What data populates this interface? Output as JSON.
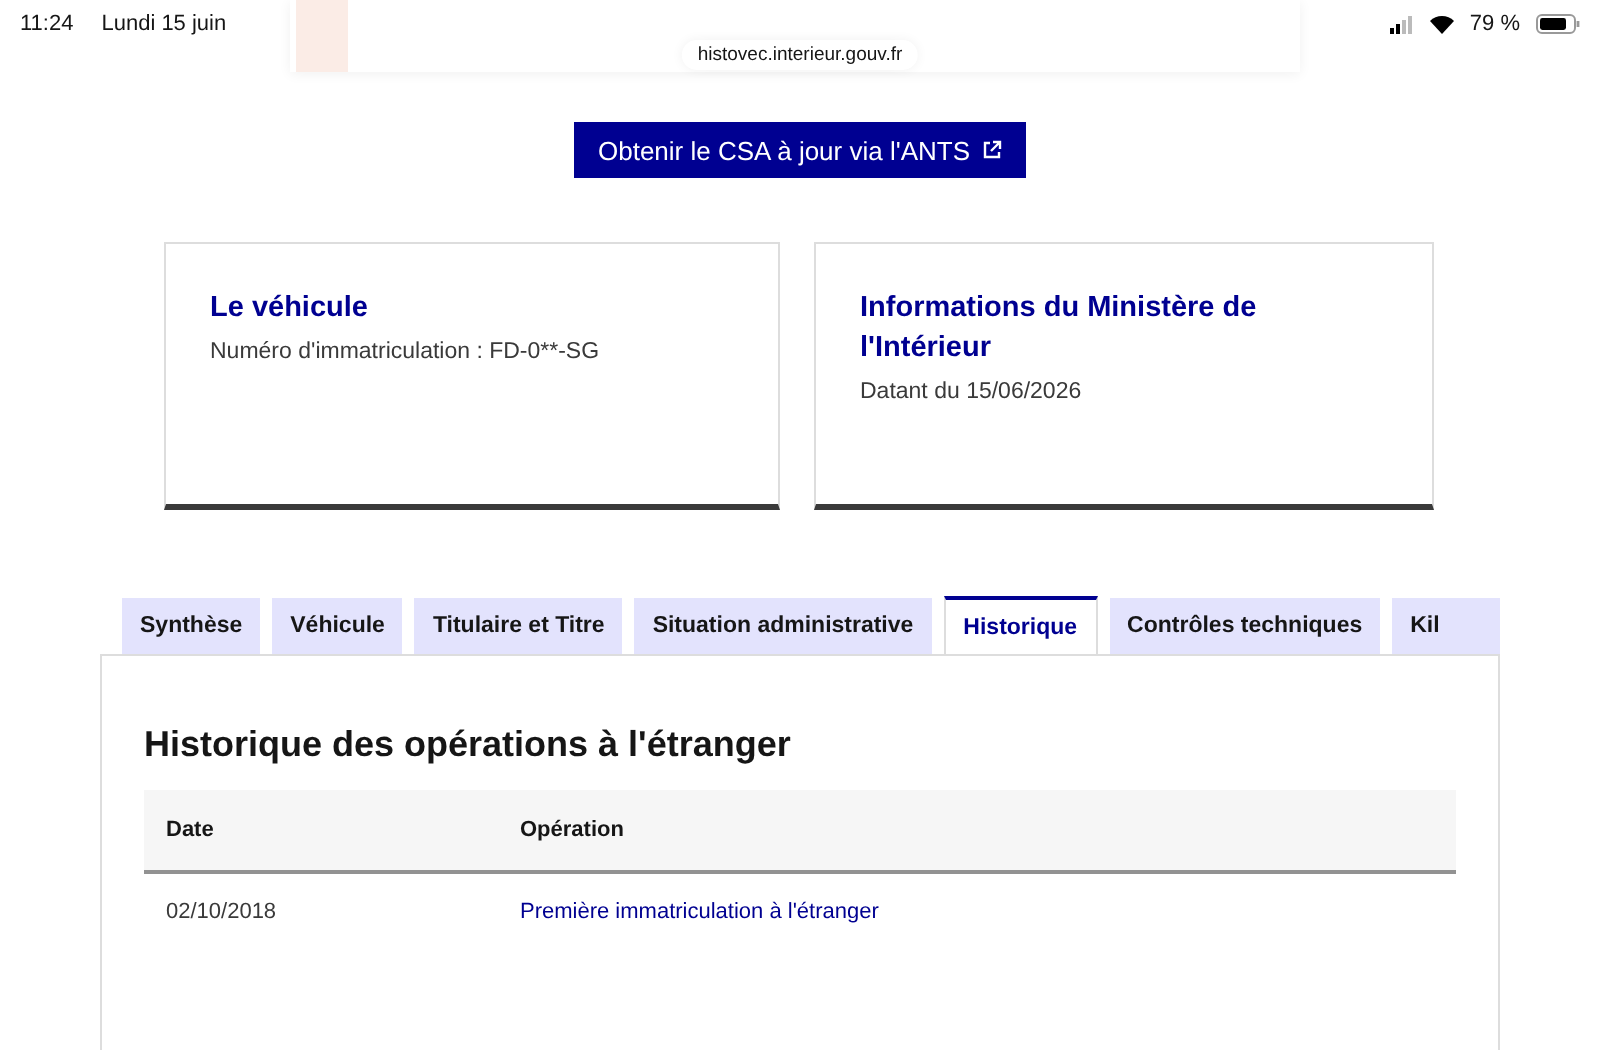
{
  "status_bar": {
    "time": "11:24",
    "date": "Lundi 15 juin",
    "battery": "79 %"
  },
  "address_bar": {
    "url": "histovec.interieur.gouv.fr"
  },
  "csa_button": {
    "label": "Obtenir le CSA à jour via l'ANTS"
  },
  "cards": [
    {
      "title": "Le véhicule",
      "text": "Numéro d'immatriculation : FD-0**-SG"
    },
    {
      "title": "Informations du Ministère de l'Intérieur",
      "text": "Datant du 15/06/2026"
    }
  ],
  "tabs": [
    {
      "label": "Synthèse",
      "selected": false
    },
    {
      "label": "Véhicule",
      "selected": false
    },
    {
      "label": "Titulaire et Titre",
      "selected": false
    },
    {
      "label": "Situation administrative",
      "selected": false
    },
    {
      "label": "Historique",
      "selected": true
    },
    {
      "label": "Contrôles techniques",
      "selected": false
    },
    {
      "label": "Kil",
      "selected": false
    }
  ],
  "panel": {
    "title": "Historique des opérations à l'étranger",
    "table": {
      "columns": [
        "Date",
        "Opération"
      ],
      "rows": [
        {
          "date": "02/10/2018",
          "operation": "Première immatriculation à l'étranger"
        }
      ]
    }
  }
}
